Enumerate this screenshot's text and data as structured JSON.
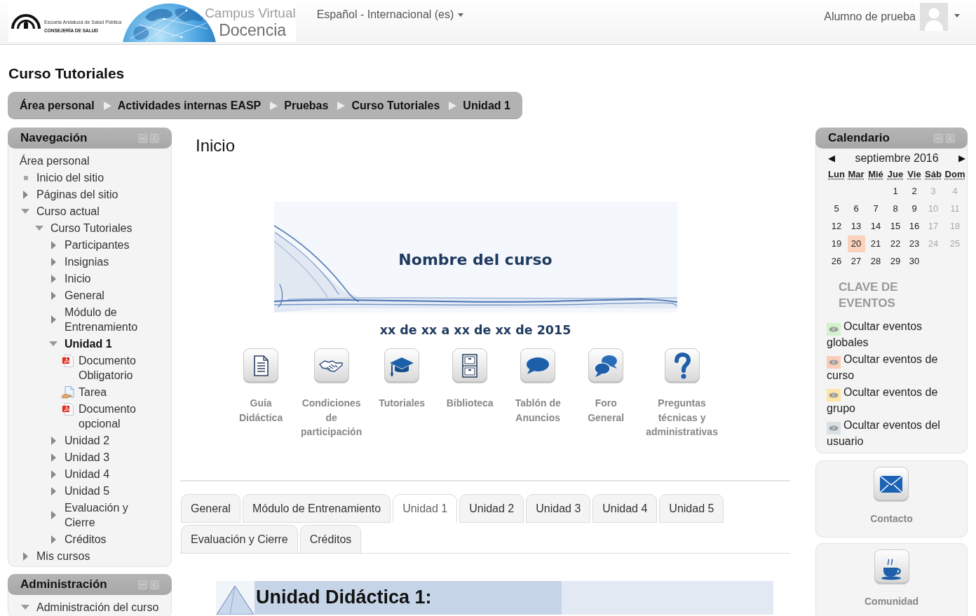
{
  "header": {
    "logo": {
      "org_name": "Escuela Andaluza de Salud Pública",
      "department": "CONSEJERÍA DE SALUD",
      "campus": "Campus Virtual",
      "site_name": "Docencia"
    },
    "language_menu": "Español - Internacional (es)",
    "user_menu": "Alumno de prueba"
  },
  "page_title": "Curso Tutoriales",
  "breadcrumb": [
    "Área personal",
    "Actividades internas EASP",
    "Pruebas",
    "Curso Tutoriales",
    "Unidad 1"
  ],
  "navigation": {
    "title": "Navegación",
    "items": [
      {
        "label": "Área personal",
        "kind": "home",
        "current": false
      },
      {
        "label": "Inicio del sitio",
        "kind": "page",
        "current": false
      },
      {
        "label": "Páginas del sitio",
        "kind": "branch",
        "expanded": false,
        "current": false
      },
      {
        "label": "Curso actual",
        "kind": "branch",
        "expanded": true,
        "current": false,
        "children": [
          {
            "label": "Curso Tutoriales",
            "kind": "branch",
            "expanded": true,
            "current": false,
            "children": [
              {
                "label": "Participantes",
                "kind": "branch",
                "expanded": false,
                "current": false
              },
              {
                "label": "Insignias",
                "kind": "branch",
                "expanded": false,
                "current": false
              },
              {
                "label": "Inicio",
                "kind": "branch",
                "expanded": false,
                "current": false
              },
              {
                "label": "General",
                "kind": "branch",
                "expanded": false,
                "current": false
              },
              {
                "label": "Módulo de Entrenamiento",
                "kind": "branch",
                "expanded": false,
                "current": false
              },
              {
                "label": "Unidad 1",
                "kind": "branch",
                "expanded": true,
                "current": true,
                "children": [
                  {
                    "label": "Documento Obligatorio",
                    "kind": "pdf",
                    "current": false
                  },
                  {
                    "label": "Tarea",
                    "kind": "assignment",
                    "current": false
                  },
                  {
                    "label": "Documento opcional",
                    "kind": "pdf",
                    "current": false
                  }
                ]
              },
              {
                "label": "Unidad 2",
                "kind": "branch",
                "expanded": false,
                "current": false
              },
              {
                "label": "Unidad 3",
                "kind": "branch",
                "expanded": false,
                "current": false
              },
              {
                "label": "Unidad 4",
                "kind": "branch",
                "expanded": false,
                "current": false
              },
              {
                "label": "Unidad 5",
                "kind": "branch",
                "expanded": false,
                "current": false
              },
              {
                "label": "Evaluación y Cierre",
                "kind": "branch",
                "expanded": false,
                "current": false
              },
              {
                "label": "Créditos",
                "kind": "branch",
                "expanded": false,
                "current": false
              }
            ]
          }
        ]
      },
      {
        "label": "Mis cursos",
        "kind": "branch",
        "expanded": false,
        "current": false
      }
    ]
  },
  "administration": {
    "title": "Administración",
    "items": [
      {
        "label": "Administración del curso",
        "kind": "branch",
        "expanded": true,
        "current": false
      }
    ]
  },
  "main": {
    "heading": "Inicio",
    "banner_title": "Nombre del curso",
    "dates": "xx de xx a xx de xx de 2015",
    "resources": [
      "Guía Didáctica",
      "Condiciones de participación",
      "Tutoriales",
      "Biblioteca",
      "Tablón de Anuncios",
      "Foro General",
      "Preguntas técnicas y administrativas"
    ],
    "tabs": [
      {
        "label": "General",
        "selected": false
      },
      {
        "label": "Módulo de Entrenamiento",
        "selected": false
      },
      {
        "label": "Unidad 1",
        "selected": true
      },
      {
        "label": "Unidad 2",
        "selected": false
      },
      {
        "label": "Unidad 3",
        "selected": false
      },
      {
        "label": "Unidad 4",
        "selected": false
      },
      {
        "label": "Unidad 5",
        "selected": false
      },
      {
        "label": "Evaluación y Cierre",
        "selected": false
      },
      {
        "label": "Créditos",
        "selected": false
      }
    ],
    "unit_banner": {
      "title": "Unidad Didáctica 1:"
    }
  },
  "calendar": {
    "title": "Calendario",
    "prev": "◀",
    "month": "septiembre 2016",
    "next": "▶",
    "weekdays": [
      "Lun",
      "Mar",
      "Mié",
      "Jue",
      "Vie",
      "Sáb",
      "Dom"
    ],
    "weeks": [
      [
        {
          "day": "1",
          "today": false
        },
        {
          "day": "2",
          "today": false
        },
        {
          "day": "3",
          "today": false
        },
        {
          "day": "4",
          "today": false
        }
      ],
      [
        {
          "day": "5",
          "today": false
        },
        {
          "day": "6",
          "today": false
        },
        {
          "day": "7",
          "today": false
        },
        {
          "day": "8",
          "today": false
        },
        {
          "day": "9",
          "today": false
        },
        {
          "day": "10",
          "today": false
        },
        {
          "day": "11",
          "today": false
        }
      ],
      [
        {
          "day": "12",
          "today": false
        },
        {
          "day": "13",
          "today": false
        },
        {
          "day": "14",
          "today": false
        },
        {
          "day": "15",
          "today": false
        },
        {
          "day": "16",
          "today": false
        },
        {
          "day": "17",
          "today": false
        },
        {
          "day": "18",
          "today": false
        }
      ],
      [
        {
          "day": "19",
          "today": false
        },
        {
          "day": "20",
          "today": true
        },
        {
          "day": "21",
          "today": false
        },
        {
          "day": "22",
          "today": false
        },
        {
          "day": "23",
          "today": false
        },
        {
          "day": "24",
          "today": false
        },
        {
          "day": "25",
          "today": false
        }
      ],
      [
        {
          "day": "26",
          "today": false
        },
        {
          "day": "27",
          "today": false
        },
        {
          "day": "28",
          "today": false
        },
        {
          "day": "29",
          "today": false
        },
        {
          "day": "30",
          "today": false
        }
      ]
    ],
    "legend_title": "CLAVE DE EVENTOS",
    "legend": [
      {
        "label": "Ocultar eventos globales",
        "color": "#d3f1cd"
      },
      {
        "label": "Ocultar eventos de curso",
        "color": "#fbcdb9"
      },
      {
        "label": "Ocultar eventos de grupo",
        "color": "#fde5a8"
      },
      {
        "label": "Ocultar eventos del usuario",
        "color": "#d8e1e5"
      }
    ]
  },
  "blocks": [
    {
      "label": "Contacto"
    },
    {
      "label": "Comunidad"
    }
  ]
}
